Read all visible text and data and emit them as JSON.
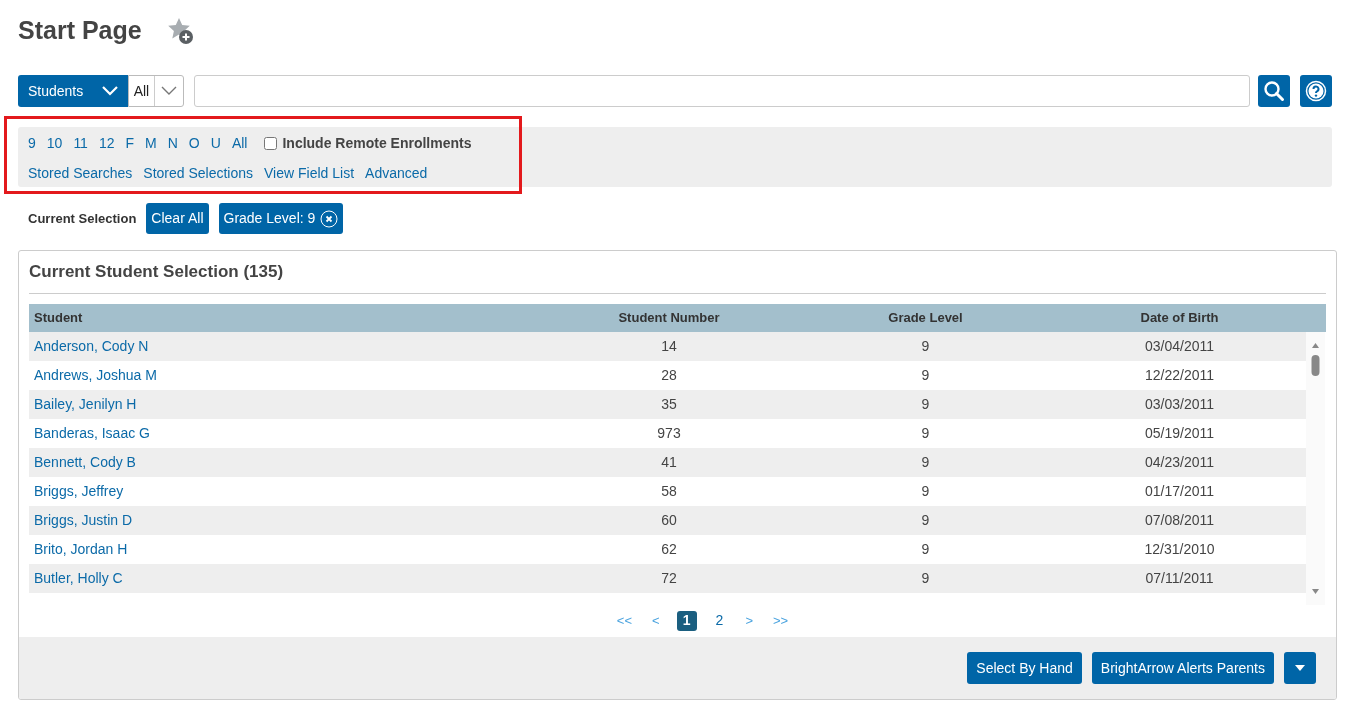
{
  "page_title": "Start Page",
  "search_bar": {
    "type_dropdown": "Students",
    "scope_dropdown": "All"
  },
  "filter_panel": {
    "grade_links": [
      "9",
      "10",
      "11",
      "12",
      "F",
      "M",
      "N",
      "O",
      "U",
      "All"
    ],
    "include_remote_enrollments": {
      "label": "Include Remote Enrollments",
      "checked": false
    },
    "links": [
      "Stored Searches",
      "Stored Selections",
      "View Field List",
      "Advanced"
    ]
  },
  "current_selection": {
    "label": "Current Selection",
    "clear_button": "Clear All",
    "chips": [
      "Grade Level: 9"
    ]
  },
  "selection_card": {
    "title": "Current Student Selection (135)",
    "table": {
      "columns": [
        "Student",
        "Student Number",
        "Grade Level",
        "Date of Birth"
      ],
      "rows": [
        [
          "Anderson, Cody N",
          "14",
          "9",
          "03/04/2011"
        ],
        [
          "Andrews, Joshua M",
          "28",
          "9",
          "12/22/2011"
        ],
        [
          "Bailey, Jenilyn H",
          "35",
          "9",
          "03/03/2011"
        ],
        [
          "Banderas, Isaac G",
          "973",
          "9",
          "05/19/2011"
        ],
        [
          "Bennett, Cody B",
          "41",
          "9",
          "04/23/2011"
        ],
        [
          "Briggs, Jeffrey",
          "58",
          "9",
          "01/17/2011"
        ],
        [
          "Briggs, Justin D",
          "60",
          "9",
          "07/08/2011"
        ],
        [
          "Brito, Jordan H",
          "62",
          "9",
          "12/31/2010"
        ],
        [
          "Butler, Holly C",
          "72",
          "9",
          "07/11/2011"
        ]
      ]
    },
    "pager": [
      {
        "label": "<<",
        "kind": "nav",
        "selected": false
      },
      {
        "label": "<",
        "kind": "nav",
        "selected": false
      },
      {
        "label": "1",
        "kind": "page",
        "selected": true
      },
      {
        "label": "2",
        "kind": "page",
        "selected": false
      },
      {
        "label": ">",
        "kind": "nav",
        "selected": false
      },
      {
        "label": ">>",
        "kind": "nav",
        "selected": false
      }
    ],
    "footer_buttons": [
      "Select By Hand",
      "BrightArrow Alerts Parents"
    ]
  }
}
